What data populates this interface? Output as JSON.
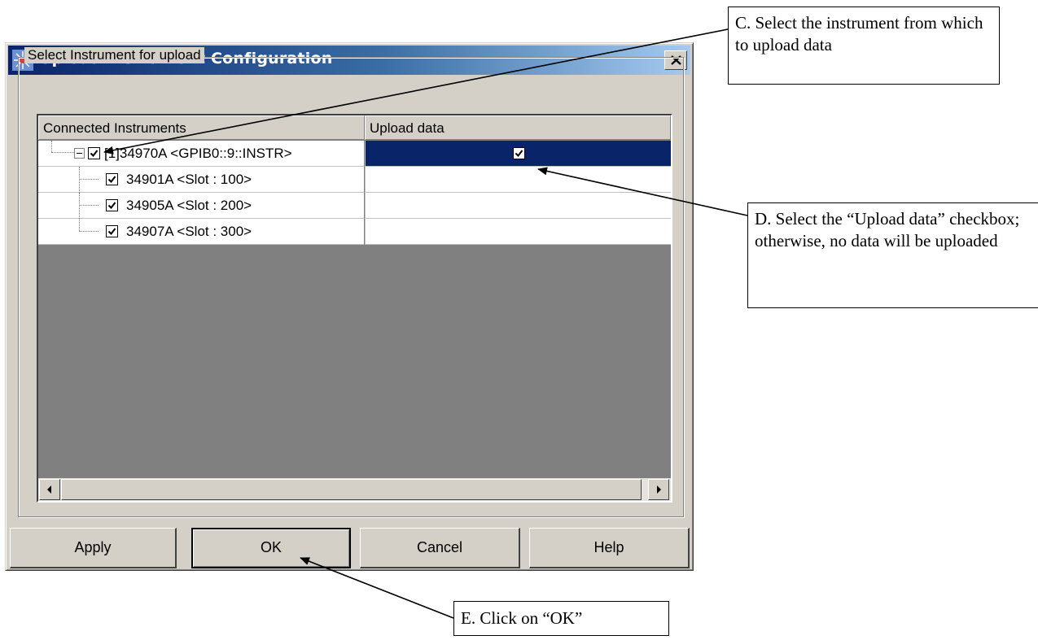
{
  "dialog": {
    "title": "Upload Instrument Configuration",
    "group_label": "Select Instrument for upload",
    "columns": [
      "Connected Instruments",
      "Upload data"
    ],
    "rows": [
      {
        "label": "[1]34970A <GPIB0::9::INSTR>",
        "checked": true,
        "upload_data": true,
        "selected": true,
        "level": 0
      },
      {
        "label": "34901A <Slot : 100>",
        "checked": true,
        "level": 1
      },
      {
        "label": "34905A <Slot : 200>",
        "checked": true,
        "level": 1
      },
      {
        "label": "34907A <Slot : 300>",
        "checked": true,
        "level": 1
      }
    ],
    "buttons": {
      "apply": "Apply",
      "ok": "OK",
      "cancel": "Cancel",
      "help": "Help"
    }
  },
  "callouts": {
    "c": "C. Select the instrument from which to upload data",
    "d": "D. Select the “Upload data” checkbox; otherwise, no data will be uploaded",
    "e": "E. Click on “OK”"
  },
  "colors": {
    "title_gradient_start": "#0a246a",
    "selected_row": "#0a246a",
    "dialog_face": "#d4d0c8",
    "grid_background": "#808080"
  },
  "icons": [
    "app-icon",
    "close-icon",
    "collapse-icon",
    "checkbox-icon",
    "scroll-left-icon",
    "scroll-right-icon"
  ]
}
